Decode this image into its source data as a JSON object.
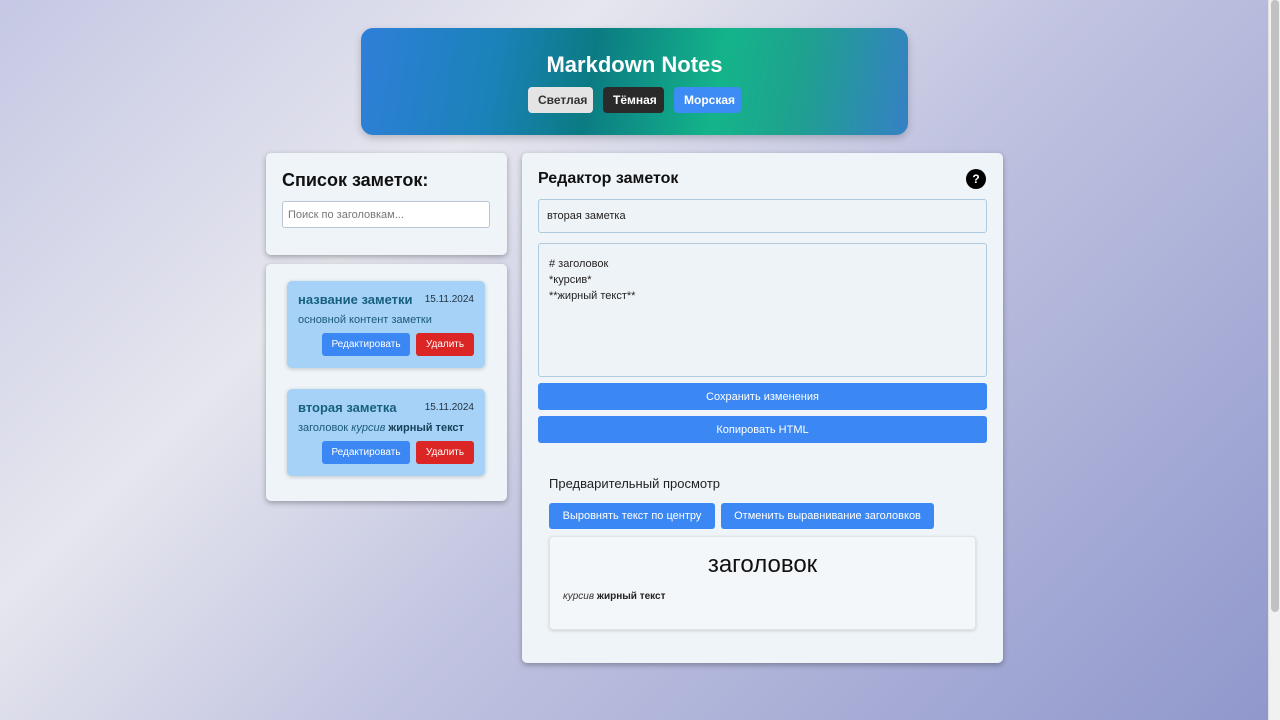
{
  "app": {
    "title": "Markdown Notes",
    "themes": [
      "Светлая",
      "Тёмная",
      "Морская"
    ]
  },
  "list": {
    "heading": "Список заметок:",
    "search_placeholder": "Поиск по заголовкам...",
    "notes": [
      {
        "title": "название заметки",
        "date": "15.11.2024",
        "preview_plain": "основной контент заметки",
        "edit_label": "Редактировать",
        "delete_label": "Удалить"
      },
      {
        "title": "вторая заметка",
        "date": "15.11.2024",
        "preview_text": "заголовок",
        "preview_italic": "курсив",
        "preview_bold": "жирный текст",
        "edit_label": "Редактировать",
        "delete_label": "Удалить"
      }
    ]
  },
  "editor": {
    "heading": "Редактор заметок",
    "help_label": "?",
    "title_value": "вторая заметка",
    "content_value": "# заголовок\n*курсив*\n**жирный текст**",
    "save_label": "Сохранить изменения",
    "copy_label": "Копировать HTML",
    "preview_label": "Предварительный просмотр",
    "center_label": "Выровнять текст по центру",
    "unalign_label": "Отменить выравнивание заголовков",
    "preview": {
      "heading": "заголовок",
      "italic": "курсив",
      "bold": "жирный текст"
    }
  },
  "colors": {
    "accent": "#3b87f3",
    "danger": "#dc2626",
    "card": "#a5d2f6"
  }
}
